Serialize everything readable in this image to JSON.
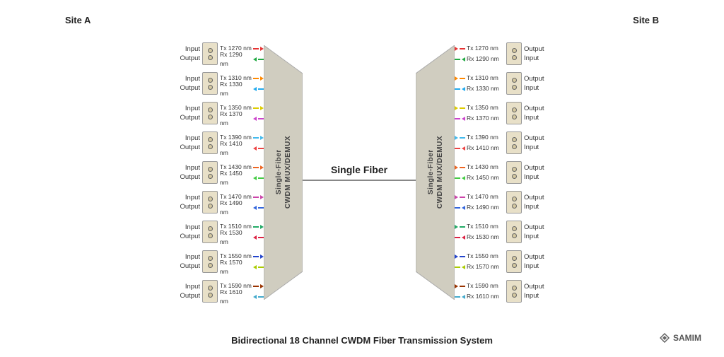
{
  "title": "Bidirectional 18 Channel CWDM Fiber Transmission System",
  "site_a": "Site A",
  "site_b": "Site B",
  "mux_label": "Single-Fiber\nCWDM MUX/DEMUX",
  "fiber_label": "Single Fiber",
  "samim": "SAMIM",
  "channels": [
    {
      "tx": "Tx 1270 nm",
      "rx": "Rx 1290 nm",
      "tx_color": "#e63333",
      "rx_color": "#22aa44"
    },
    {
      "tx": "Tx 1310 nm",
      "rx": "Rx 1330 nm",
      "tx_color": "#ff8800",
      "rx_color": "#22aaee"
    },
    {
      "tx": "Tx 1350 nm",
      "rx": "Rx 1370 nm",
      "tx_color": "#ddcc00",
      "rx_color": "#cc44cc"
    },
    {
      "tx": "Tx 1390 nm",
      "rx": "Rx 1410 nm",
      "tx_color": "#44bbee",
      "rx_color": "#ee4444"
    },
    {
      "tx": "Tx 1430 nm",
      "rx": "Rx 1450 nm",
      "tx_color": "#ee6622",
      "rx_color": "#44cc44"
    },
    {
      "tx": "Tx 1470 nm",
      "rx": "Rx 1490 nm",
      "tx_color": "#cc44aa",
      "rx_color": "#3366dd"
    },
    {
      "tx": "Tx 1510 nm",
      "rx": "Rx 1530 nm",
      "tx_color": "#22aa66",
      "rx_color": "#dd2244"
    },
    {
      "tx": "Tx 1550 nm",
      "rx": "Rx 1570 nm",
      "tx_color": "#2244cc",
      "rx_color": "#aacc00"
    },
    {
      "tx": "Tx 1590 nm",
      "rx": "Rx 1610 nm",
      "tx_color": "#993300",
      "rx_color": "#44aacc"
    }
  ]
}
